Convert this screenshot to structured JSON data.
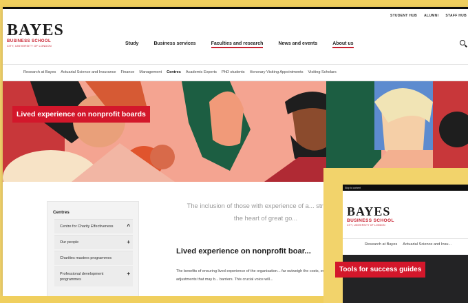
{
  "utility_nav": [
    "STUDENT HUB",
    "ALUMNI",
    "STAFF HUB"
  ],
  "logo": {
    "name": "BAYES",
    "school": "BUSINESS SCHOOL",
    "tagline": "CITY, UNIVERSITY OF LONDON"
  },
  "main_nav": [
    {
      "label": "Study"
    },
    {
      "label": "Business services"
    },
    {
      "label": "Faculties and research"
    },
    {
      "label": "News and events"
    },
    {
      "label": "About us"
    }
  ],
  "sub_nav": [
    {
      "label": "Research at Bayes"
    },
    {
      "label": "Actuarial Science and Insurance"
    },
    {
      "label": "Finance"
    },
    {
      "label": "Management"
    },
    {
      "label": "Centres"
    },
    {
      "label": "Academic Experts"
    },
    {
      "label": "PhD students"
    },
    {
      "label": "Honorary Visiting Appointments"
    },
    {
      "label": "Visiting Scholars"
    }
  ],
  "hero": {
    "title": "Lived experience on nonprofit boards"
  },
  "sidebar": {
    "heading": "Centres",
    "items": [
      {
        "label": "Centre for Charity Effectiveness",
        "toggle": "^"
      },
      {
        "label": "Our people",
        "toggle": "+"
      },
      {
        "label": "Charities masters programmes",
        "toggle": ""
      },
      {
        "label": "Professional development programmes",
        "toggle": "+"
      }
    ]
  },
  "content": {
    "intro_quote": "The inclusion of those with experience of a... straight to the heart of great go...",
    "heading": "Lived experience on nonprofit boar...",
    "body": "The benefits of ensuring lived experience of the organisation... far outweigh the costs, even with the adjustments that may b... barriers. This crucial voice will..."
  },
  "inset": {
    "skip_label": "Skip to content",
    "logo_name": "BAYES",
    "logo_school": "BUSINESS SCHOOL",
    "logo_tagline": "CITY, UNIVERSITY OF LONDON",
    "sub_nav": [
      "Research at Bayes",
      "Actuarial Science and Insu..."
    ],
    "hero_title": "Tools for success guides"
  },
  "colors": {
    "brand_red": "#d3172b",
    "background_yellow": "#f2d36b",
    "dark_strip": "#0d0d0d"
  }
}
